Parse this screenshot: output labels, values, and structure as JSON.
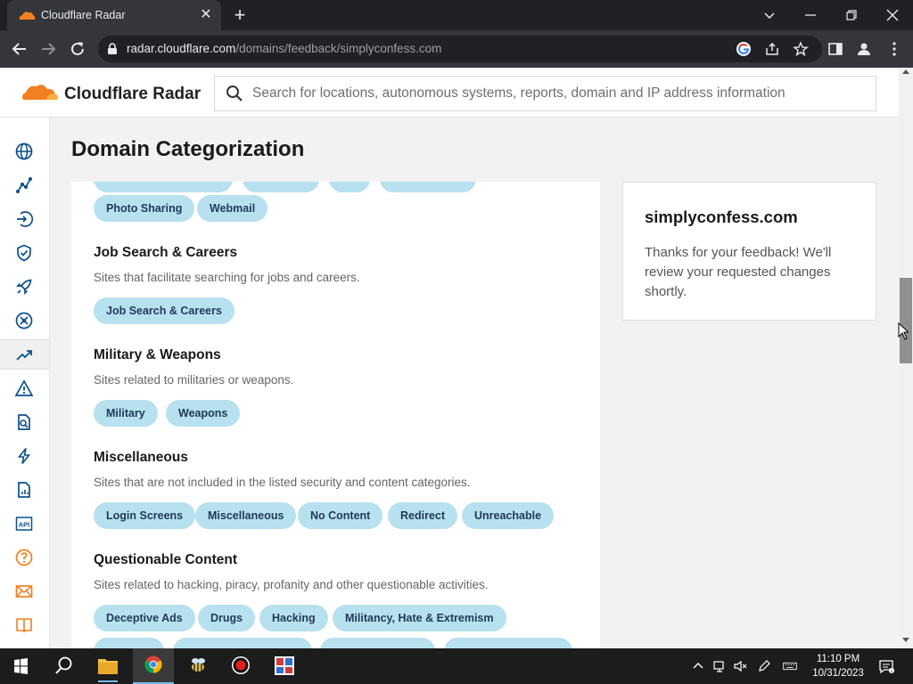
{
  "browser": {
    "tab_title": "Cloudflare Radar",
    "url_host": "radar.cloudflare.com",
    "url_path": "/domains/feedback/simplyconfess.com"
  },
  "header": {
    "brand": "Cloudflare Radar",
    "search_placeholder": "Search for locations, autonomous systems, reports, domain and IP address information"
  },
  "page": {
    "title": "Domain Categorization"
  },
  "card": {
    "top_chips": [
      "Photo Sharing",
      "Webmail"
    ],
    "sections": [
      {
        "title": "Job Search & Careers",
        "description": "Sites that facilitate searching for jobs and careers.",
        "chips": [
          "Job Search & Careers"
        ]
      },
      {
        "title": "Military & Weapons",
        "description": "Sites related to militaries or weapons.",
        "chips": [
          "Military",
          "Weapons"
        ]
      },
      {
        "title": "Miscellaneous",
        "description": "Sites that are not included in the listed security and content categories.",
        "chips": [
          "Login Screens",
          "Miscellaneous",
          "No Content",
          "Redirect",
          "Unreachable"
        ]
      },
      {
        "title": "Questionable Content",
        "description": "Sites related to hacking, piracy, profanity and other questionable activities.",
        "chips": [
          "Deceptive Ads",
          "Drugs",
          "Hacking",
          "Militancy, Hate & Extremism"
        ]
      }
    ]
  },
  "aside": {
    "domain": "simplyconfess.com",
    "message": "Thanks for your feedback! We'll review your requested changes shortly."
  },
  "taskbar": {
    "time": "11:10 PM",
    "date": "10/31/2023"
  },
  "colors": {
    "brand_orange": "#f38020",
    "chip_bg": "#b8e1ef",
    "chip_text": "#1f3a55",
    "icon_blue": "#0b4f8a"
  }
}
